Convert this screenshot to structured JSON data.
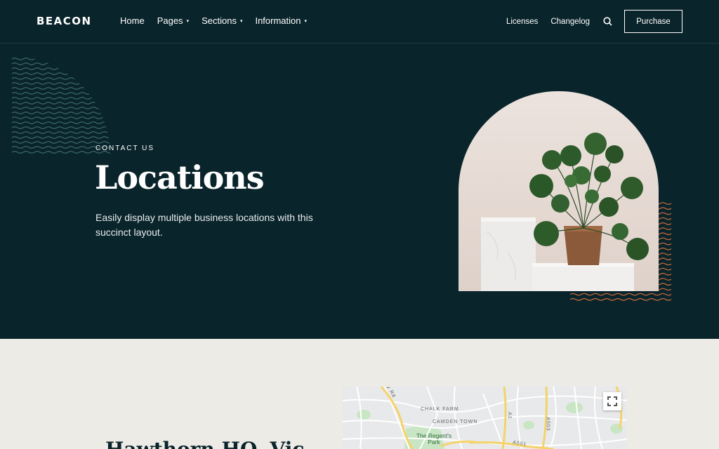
{
  "header": {
    "logo": "BEACON",
    "nav": [
      {
        "label": "Home",
        "has_dropdown": false
      },
      {
        "label": "Pages",
        "has_dropdown": true
      },
      {
        "label": "Sections",
        "has_dropdown": true
      },
      {
        "label": "Information",
        "has_dropdown": true
      }
    ],
    "right_links": [
      "Licenses",
      "Changelog"
    ],
    "search_icon": "search-icon",
    "purchase_label": "Purchase"
  },
  "hero": {
    "eyebrow": "CONTACT US",
    "title": "Locations",
    "description": "Easily display multiple business locations with this succinct layout.",
    "accent_color": "#c0693a"
  },
  "location": {
    "title": "Hawthorn HQ, Vic"
  },
  "map": {
    "labels": [
      "CHALK FARM",
      "CAMDEN TOWN",
      "The Regent's Park",
      "A501",
      "A1",
      "A503"
    ],
    "fullscreen_icon": "fullscreen-icon"
  },
  "colors": {
    "background": "#0a242b",
    "lower_background": "#edebe6",
    "wave_teal": "#3d6b6b",
    "wave_orange": "#c0693a"
  }
}
